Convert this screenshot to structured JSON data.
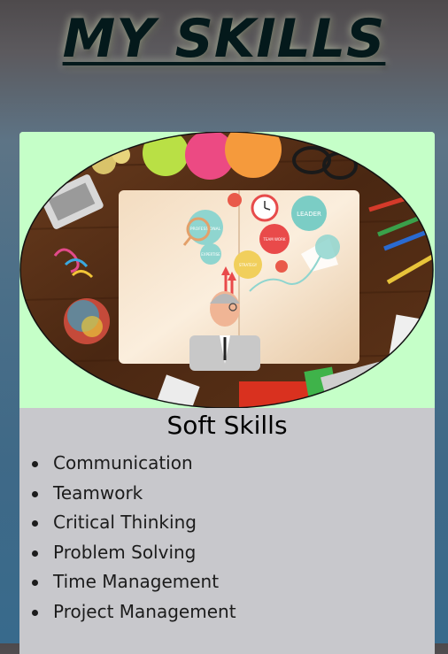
{
  "page": {
    "title": "MY SKILLS"
  },
  "card": {
    "title": "Soft Skills",
    "image": {
      "labels": {
        "leader": "LEADER",
        "professional": "PROFESSIONAL",
        "expertise": "EXPERTISE",
        "strategy": "STRATEGY",
        "team_work": "TEAM WORK"
      }
    },
    "skills": [
      "Communication",
      "Teamwork",
      "Critical Thinking",
      "Problem Solving",
      "Time Management",
      "Project Management"
    ]
  },
  "colors": {
    "title": "#04191b",
    "card_background": "#c8c8cc",
    "image_background": "#c5ffc8"
  }
}
